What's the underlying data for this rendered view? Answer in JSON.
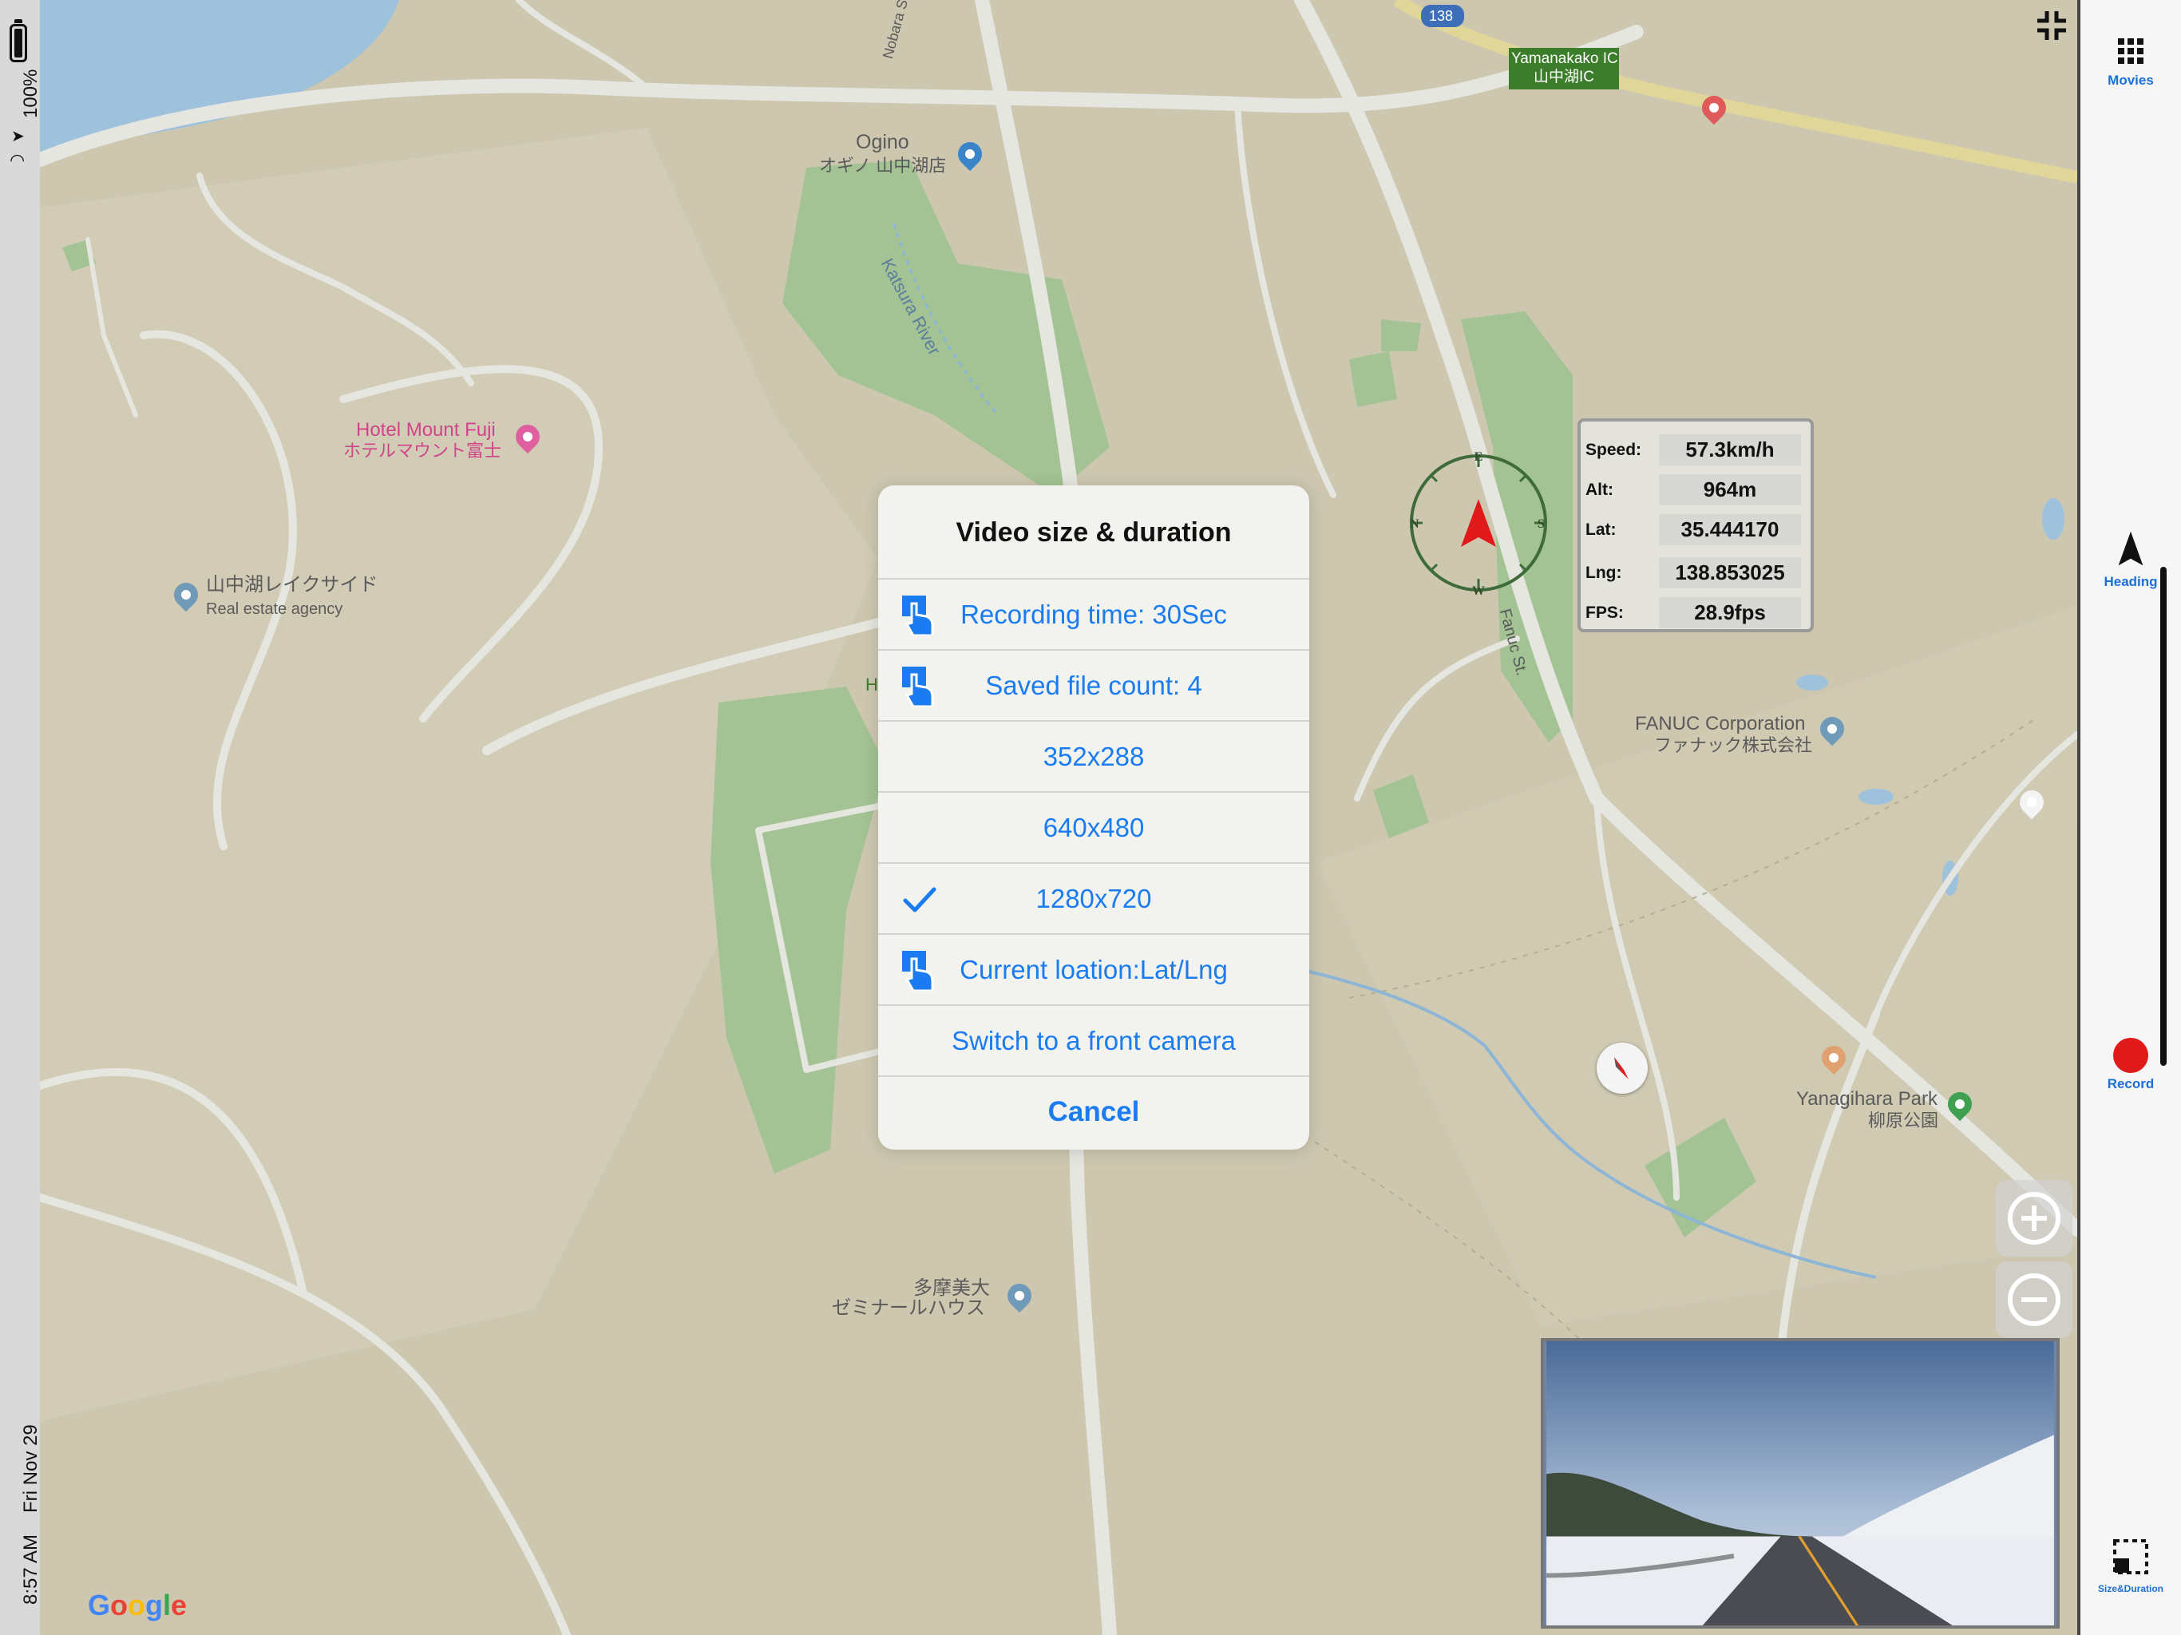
{
  "status_bar": {
    "battery": "100%",
    "time": "8:57 AM",
    "date": "Fri Nov 29"
  },
  "map": {
    "labels": {
      "ogino_en": "Ogino",
      "ogino_jp": "オギノ 山中湖店",
      "katsura": "Katsura River",
      "nobara": "Nobara St",
      "hotel_en": "Hotel Mount Fuji",
      "hotel_jp": "ホテルマウント富士",
      "lakeside_jp": "山中湖レイクサイド",
      "lakeside_sub": "Real estate agency",
      "fanuc_en": "FANUC Corporation",
      "fanuc_jp": "ファナック株式会社",
      "fanuc_st": "Fanuc St.",
      "yanagihara_en": "Yanagihara Park",
      "yanagihara_jp": "柳原公園",
      "tama_jp1": "多摩美大",
      "tama_jp2": "ゼミナールハウス",
      "yamanakako_ic_en": "Yamanakako IC",
      "yamanakako_ic_jp": "山中湖IC",
      "route_138": "138",
      "partial_h": "H"
    },
    "google_logo": "Google"
  },
  "compass": {
    "n": "N",
    "e": "E",
    "s": "S",
    "w": "W"
  },
  "info_panel": {
    "speed_label": "Speed:",
    "speed": "57.3km/h",
    "alt_label": "Alt:",
    "alt": "964m",
    "lat_label": "Lat:",
    "lat": "35.444170",
    "lng_label": "Lng:",
    "lng": "138.853025",
    "fps_label": "FPS:",
    "fps": "28.9fps"
  },
  "toolbar": {
    "movies_label": "Movies",
    "heading_label": "Heading",
    "record_label": "Record",
    "size_label": "Size&Duration"
  },
  "dialog": {
    "title": "Video size & duration",
    "items": [
      {
        "label": "Recording time: 30Sec",
        "icon": "tap-hand-icon"
      },
      {
        "label": "Saved file count: 4",
        "icon": "tap-hand-icon"
      },
      {
        "label": "352x288"
      },
      {
        "label": "640x480"
      },
      {
        "label": "1280x720",
        "icon": "checkmark-icon",
        "selected": true
      },
      {
        "label": "Current loation:Lat/Lng",
        "icon": "tap-hand-icon"
      },
      {
        "label": "Switch to a front camera"
      },
      {
        "label": "Cancel"
      }
    ]
  },
  "colors": {
    "accent": "#1a7cf0",
    "record": "#e01a1a",
    "map_land": "#cdc7b0",
    "park": "#a3c394",
    "water": "#9ec1dc"
  }
}
